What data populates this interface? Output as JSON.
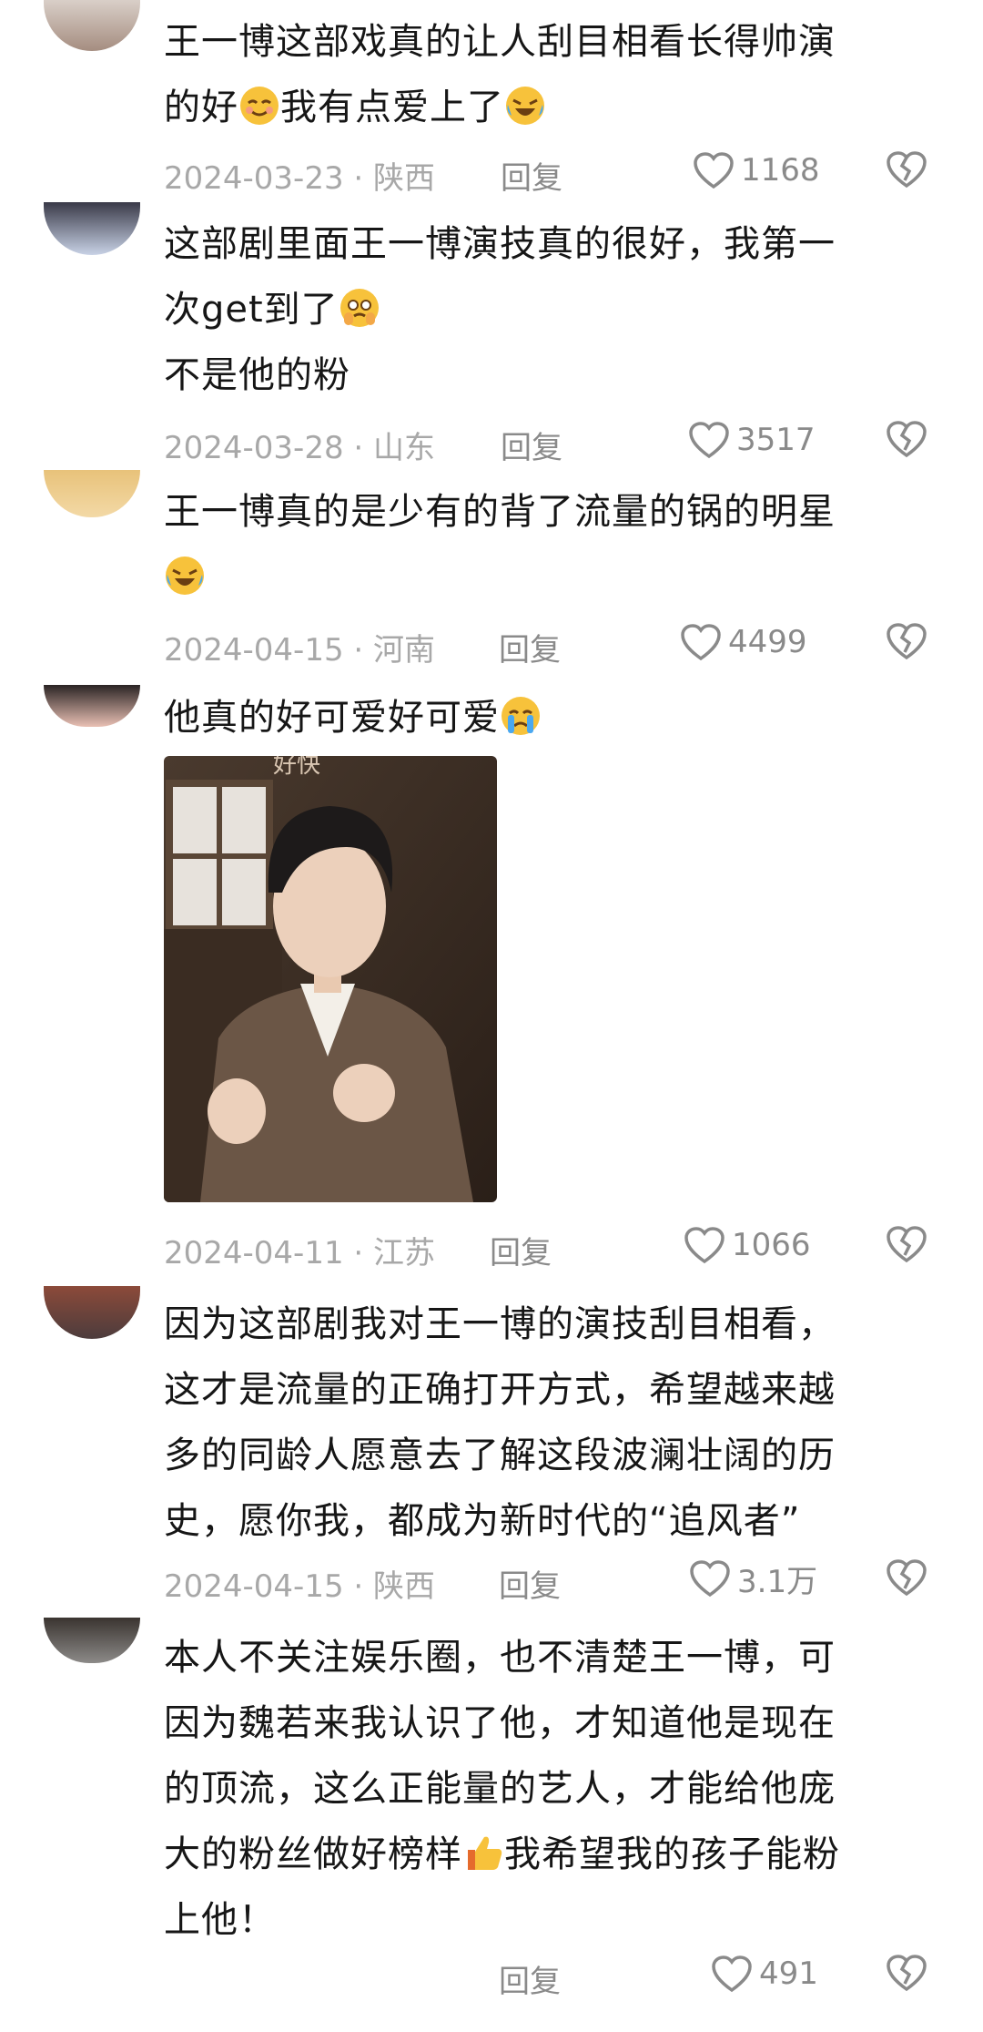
{
  "comments": [
    {
      "text_before": "王一博这部戏真的让人刮目相看长得帅演\n的好",
      "text_mid": "我有点爱上了",
      "date": "2024-03-23",
      "location": "陕西",
      "reply": "回复",
      "likes": "1168",
      "emoji1": "smiling-face-icon",
      "emoji2": "crying-laughing-face-icon"
    },
    {
      "text_before": "这部剧里面王一博演技真的很好，我第一\n次get到了",
      "text_after": "\n不是他的粉",
      "date": "2024-03-28",
      "location": "山东",
      "reply": "回复",
      "likes": "3517",
      "emoji1": "holding-back-tears-face-icon"
    },
    {
      "text_before": "王一博真的是少有的背了流量的锅的明星\n",
      "date": "2024-04-15",
      "location": "河南",
      "reply": "回复",
      "likes": "4499",
      "emoji1": "crying-laughing-face-icon"
    },
    {
      "text_before": "他真的好可爱好可爱",
      "date": "2024-04-11",
      "location": "江苏",
      "reply": "回复",
      "likes": "1066",
      "emoji1": "crying-face-icon",
      "image_label": "好快"
    },
    {
      "text_before": "因为这部剧我对王一博的演技刮目相看，\n这才是流量的正确打开方式，希望越来越\n多的同龄人愿意去了解这段波澜壮阔的历\n史，愿你我，都成为新时代的“追风者”",
      "date": "2024-04-15",
      "location": "陕西",
      "reply": "回复",
      "likes": "3.1万"
    },
    {
      "text_before": "本人不关注娱乐圈，也不清楚王一博，可\n因为魏若来我认识了他，才知道他是现在\n的顶流，这么正能量的艺人，才能给他庞\n大的粉丝做好榜样",
      "text_mid": "我希望我的孩子能粉\n上他！",
      "reply": "回复",
      "likes": "491",
      "emoji1": "thumbs-up-icon"
    }
  ],
  "colors": {
    "text": "#161616",
    "meta": "#a8a8a8",
    "icon": "#8a8a8a"
  }
}
